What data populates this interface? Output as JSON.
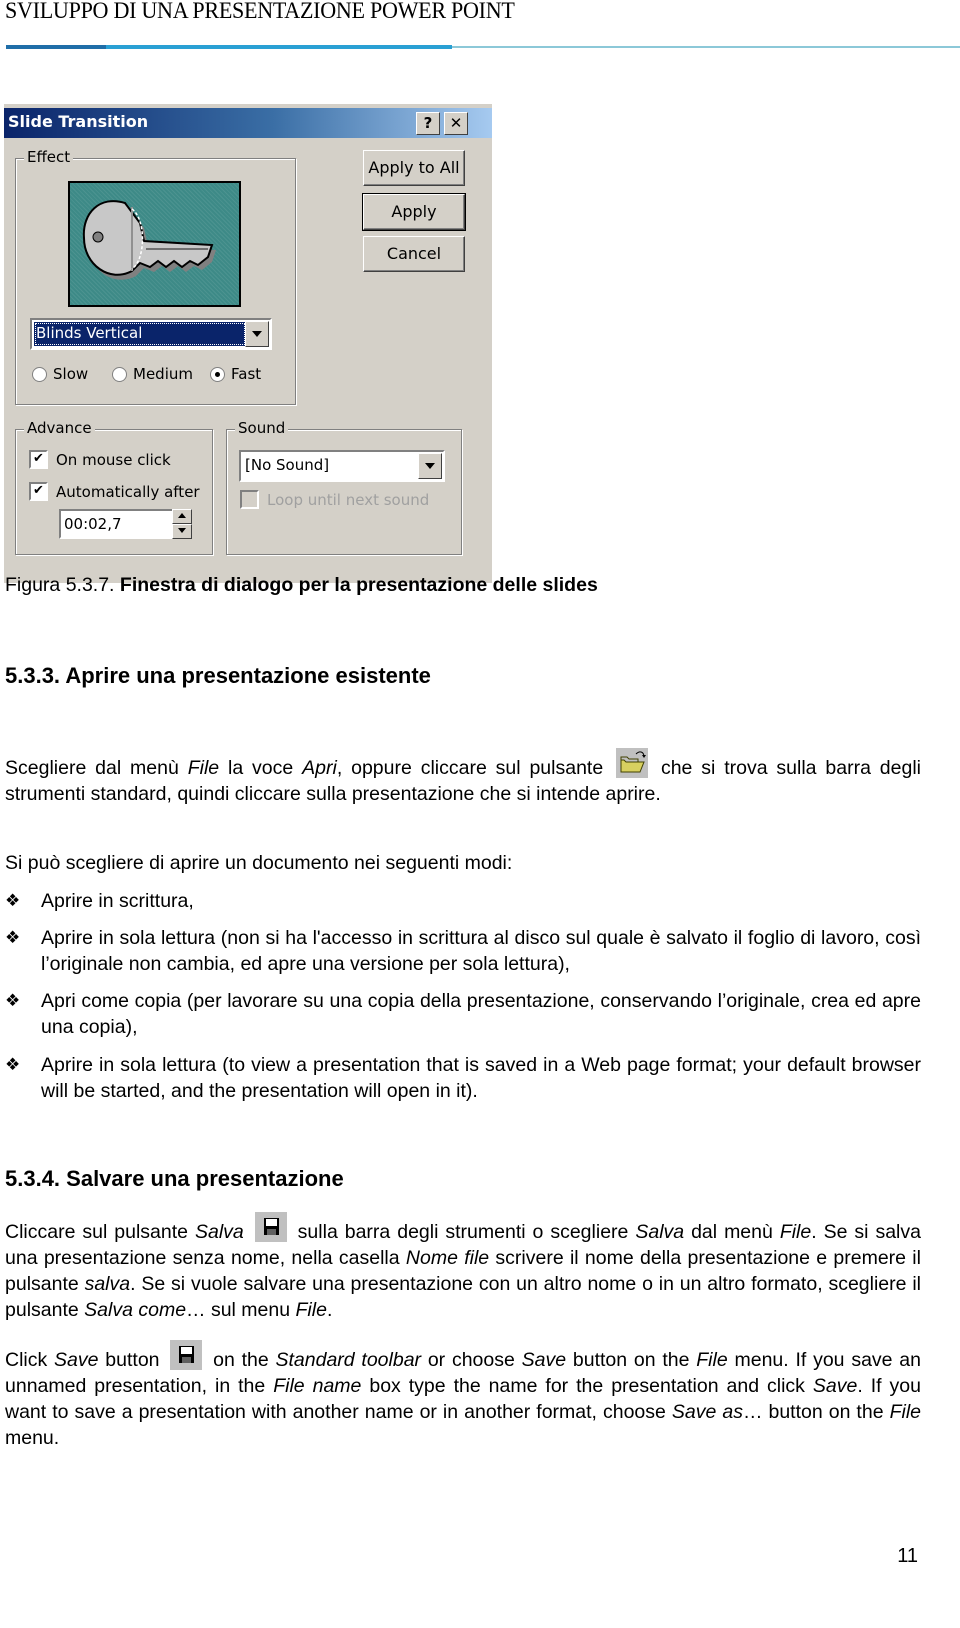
{
  "header": {
    "title": "SVILUPPO DI UNA PRESENTAZIONE POWER POINT",
    "rule_colors": [
      "#1f6ea8",
      "#2aa0d4",
      "#8cc8d8"
    ]
  },
  "dialog": {
    "title": "Slide Transition",
    "help_button": "?",
    "close_button": "✕",
    "effect": {
      "legend": "Effect",
      "preview_icon": "key-icon",
      "selected_effect": "Blinds Vertical",
      "speeds": [
        {
          "label": "Slow",
          "selected": false
        },
        {
          "label": "Medium",
          "selected": false
        },
        {
          "label": "Fast",
          "selected": true
        }
      ]
    },
    "buttons": {
      "apply_all": "Apply to All",
      "apply": "Apply",
      "cancel": "Cancel"
    },
    "advance": {
      "legend": "Advance",
      "on_mouse_click": {
        "label": "On mouse click",
        "checked": true
      },
      "automatically_after": {
        "label": "Automatically after",
        "checked": true
      },
      "time_value": "00:02,7"
    },
    "sound": {
      "legend": "Sound",
      "selected_sound": "[No Sound]",
      "loop": {
        "label": "Loop until next sound",
        "checked": false,
        "disabled": true
      }
    },
    "colors": {
      "face": "#d4d0c8",
      "title_start": "#0a246a",
      "title_end": "#a6caf0",
      "preview_bg": "#3d8a87"
    }
  },
  "caption": {
    "prefix": "Figura 5.3.7.",
    "text": " Finestra di dialogo per la presentazione delle slides"
  },
  "section_533": {
    "heading": "5.3.3. Aprire una presentazione esistente",
    "para1": {
      "t1": "Scegliere dal menù ",
      "i1": "File",
      "t2": "  la voce ",
      "i2": "Apri",
      "t3": ", oppure cliccare sul pulsante",
      "icon": "open-folder-icon",
      "t4": "che si trova sulla barra degli strumenti standard, quindi cliccare sulla presentazione che si intende aprire."
    },
    "intro": "Si può scegliere di aprire un documento nei seguenti modi:",
    "bullet_symbol": "❖",
    "bullets": [
      "Aprire in scrittura,",
      "Aprire in sola lettura (non si ha l'accesso in scrittura al disco sul quale è salvato il foglio di lavoro, così l’originale non cambia, ed apre una versione per sola lettura),",
      "Apri come copia (per lavorare su una copia della presentazione, conservando l’originale, crea ed apre una copia),",
      "Aprire in sola lettura (to view a presentation that is saved in a Web page format; your default browser will be started, and the presentation will open in it)."
    ]
  },
  "section_534": {
    "heading": "5.3.4. Salvare una presentazione",
    "para_it": {
      "t1": "Cliccare sul pulsante ",
      "i1": "Salva",
      "icon": "floppy-save-icon",
      "t2": " sulla barra degli strumenti o scegliere ",
      "i2": "Salva",
      "t3": " dal menù ",
      "i3": "File",
      "t4": ". Se si salva una presentazione senza nome, nella casella ",
      "i4": "Nome file",
      "t5": " scrivere il nome della presentazione e  premere il pulsante ",
      "i5": "salva",
      "t6": ". Se si vuole salvare una presentazione con un altro nome o in un altro formato, scegliere  il pulsante ",
      "i6": "Salva come",
      "t7": "… sul menu ",
      "i7": "File",
      "t8": "."
    },
    "para_en": {
      "t1": "Click ",
      "i1": "Save",
      "t2": " button",
      "icon": "floppy-save-icon",
      "t3": " on the ",
      "i2": "Standard toolbar",
      "t4": " or choose ",
      "i3": "Save",
      "t5": " button on the ",
      "i4": "File",
      "t6": " menu. If you save an unnamed presentation, in the ",
      "i5": "File name",
      "t7": " box type the name for the presentation and click ",
      "i6": "Save",
      "t8": ". If you want to save a presentation with another name or in another format, choose ",
      "i7": "Save as",
      "t9": "… button on the ",
      "i8": "File",
      "t10": " menu."
    }
  },
  "page_number": "11"
}
